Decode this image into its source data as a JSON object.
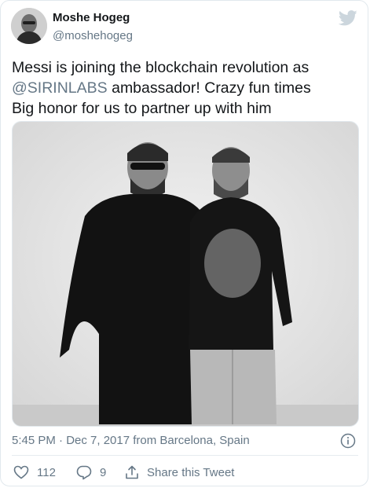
{
  "tweet": {
    "author_name": "Moshe Hogeg",
    "author_handle": "@moshehogeg",
    "text_lines": [
      "Messi is joining the blockchain revolution as",
      "ambassador! Crazy fun times",
      "Big honor for us to partner up with him"
    ],
    "mention": "@SIRINLABS",
    "timestamp": "5:45 PM · Dec 7, 2017 from Barcelona, Spain"
  },
  "actions": {
    "likes_count": "112",
    "replies_count": "9",
    "share_label": "Share this Tweet"
  },
  "icons": {
    "brand": "twitter-bird-icon",
    "info": "info-icon",
    "like": "heart-icon",
    "reply": "reply-icon",
    "share": "share-icon"
  },
  "colors": {
    "twitter_bird": "#ccd6dd",
    "secondary_text": "#657786",
    "border": "#e1e8ed"
  }
}
